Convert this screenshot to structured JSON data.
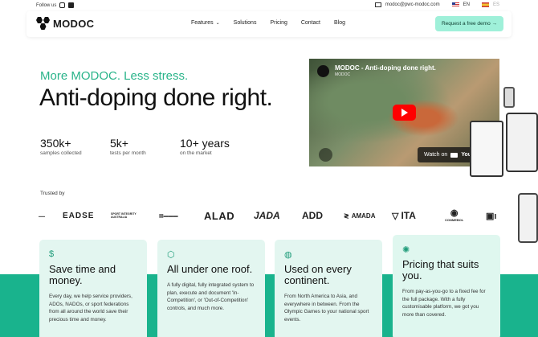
{
  "topbar": {
    "follow_label": "Follow us",
    "email": "modoc@pwc-modoc.com",
    "lang_en": "EN",
    "lang_es": "ES"
  },
  "nav": {
    "logo_text": "MODOC",
    "items": [
      "Features",
      "Solutions",
      "Pricing",
      "Contact",
      "Blog"
    ],
    "cta": "Request a free demo →"
  },
  "hero": {
    "tagline": "More MODOC. Less stress.",
    "headline": "Anti-doping done right.",
    "stats": [
      {
        "value": "350k+",
        "label": "samples collected"
      },
      {
        "value": "5k+",
        "label": "tests per month"
      },
      {
        "value": "10+ years",
        "label": "on the market"
      }
    ]
  },
  "video": {
    "title": "MODOC - Anti-doping done right.",
    "channel": "MODOC",
    "watch_label": "Watch on",
    "platform": "YouTube"
  },
  "trusted": {
    "label": "Trusted by",
    "logos": [
      "EADSE",
      "SPORT INTEGRITY AUSTRALIA",
      "ALAD",
      "JADA",
      "ADD",
      "AMADA",
      "ITA",
      "CONMEBOL"
    ]
  },
  "cards": [
    {
      "icon": "dollar-icon",
      "title": "Save time and money.",
      "text": "Every day, we help service providers, ADOs, NADOs, or sport federations from all around the world save their precious time and money."
    },
    {
      "icon": "cube-icon",
      "title": "All under one roof.",
      "text": "A fully digital, fully integrated system to plan, execute and document 'In-Competition', or 'Out-of-Competition' controls, and much more."
    },
    {
      "icon": "globe-icon",
      "title": "Used on every continent.",
      "text": "From North America to Asia, and everywhere in between. From the Olympic Games to your national sport events."
    },
    {
      "icon": "sparkle-icon",
      "title": "Pricing that suits you.",
      "text": "From pay-as-you-go to a fixed fee for the full package. With a fully customisable platform, we got you more than covered."
    }
  ],
  "colors": {
    "accent": "#2ab48a",
    "band": "#19b38d",
    "cta_bg": "#9ff0d9"
  }
}
